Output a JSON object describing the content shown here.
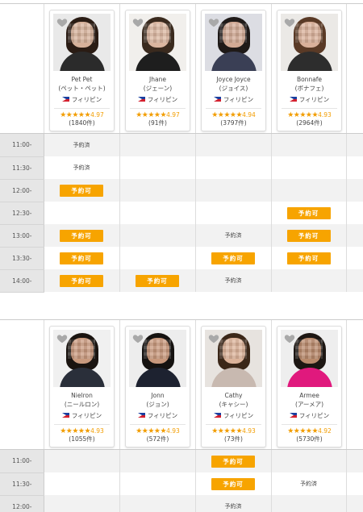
{
  "block1": {
    "tutors": [
      {
        "name": "Pet Pet",
        "kana": "(ペット・ペット)",
        "country": "フィリピン",
        "rating": "4.97",
        "count": "(1840件)",
        "stars": "★★★★★",
        "photo": {
          "bg": "#e9e9e9",
          "hair": "#2a1c14",
          "skin": "#d6b19a",
          "cloth": "#2b2b2b"
        }
      },
      {
        "name": "Jhane",
        "kana": "(ジェーン)",
        "country": "フィリピン",
        "rating": "4.97",
        "count": "(91件)",
        "stars": "★★★★★",
        "photo": {
          "bg": "#f1efec",
          "hair": "#3a2a1e",
          "skin": "#dbb6a0",
          "cloth": "#1e1e1e"
        }
      },
      {
        "name": "Joyce Joyce",
        "kana": "(ジョイス)",
        "country": "フィリピン",
        "rating": "4.94",
        "count": "(3797件)",
        "stars": "★★★★★",
        "photo": {
          "bg": "#dcdde3",
          "hair": "#1f1a18",
          "skin": "#d2aa95",
          "cloth": "#3a3f55"
        }
      },
      {
        "name": "Bonnafe",
        "kana": "(ボナフェ)",
        "country": "フィリピン",
        "rating": "4.93",
        "count": "(2964件)",
        "stars": "★★★★★",
        "photo": {
          "bg": "#ebe9e6",
          "hair": "#5a3a26",
          "skin": "#d9b09a",
          "cloth": "#2d2d2d"
        }
      }
    ],
    "times": [
      "11:00-",
      "11:30-",
      "12:00-",
      "12:30-",
      "13:00-",
      "13:30-",
      "14:00-"
    ],
    "slots": [
      [
        "予約済",
        "",
        "",
        ""
      ],
      [
        "予約済",
        "",
        "",
        ""
      ],
      [
        "予約可",
        "",
        "",
        ""
      ],
      [
        "",
        "",
        "",
        "予約可"
      ],
      [
        "予約可",
        "",
        "予約済",
        "予約可"
      ],
      [
        "予約可",
        "",
        "予約可",
        "予約可"
      ],
      [
        "予約可",
        "予約可",
        "予約済",
        ""
      ]
    ]
  },
  "block2": {
    "tutors": [
      {
        "name": "Nielron",
        "kana": "(ニールロン)",
        "country": "フィリピン",
        "rating": "4.93",
        "count": "(1055件)",
        "stars": "★★★★★",
        "photo": {
          "bg": "#f0f0f0",
          "hair": "#1a1410",
          "skin": "#c99a7e",
          "cloth": "#2a2f3a"
        }
      },
      {
        "name": "Jonn",
        "kana": "(ジョン)",
        "country": "フィリピン",
        "rating": "4.93",
        "count": "(572件)",
        "stars": "★★★★★",
        "photo": {
          "bg": "#ededed",
          "hair": "#151210",
          "skin": "#c8987c",
          "cloth": "#1d2230"
        }
      },
      {
        "name": "Cathy",
        "kana": "(キャシー)",
        "country": "フィリピン",
        "rating": "4.93",
        "count": "(73件)",
        "stars": "★★★★★",
        "photo": {
          "bg": "#e7e3df",
          "hair": "#3b2718",
          "skin": "#dcb39a",
          "cloth": "#c8b9b0"
        }
      },
      {
        "name": "Armee",
        "kana": "(アーメア)",
        "country": "フィリピン",
        "rating": "4.92",
        "count": "(5730件)",
        "stars": "★★★★★",
        "photo": {
          "bg": "#eeeeee",
          "hair": "#1d1713",
          "skin": "#b98a6c",
          "cloth": "#e0197d"
        }
      }
    ],
    "times": [
      "11:00-",
      "11:30-",
      "12:00-"
    ],
    "slots": [
      [
        "",
        "",
        "予約可",
        ""
      ],
      [
        "",
        "",
        "予約可",
        "予約済"
      ],
      [
        "",
        "",
        "予約済",
        ""
      ]
    ]
  }
}
